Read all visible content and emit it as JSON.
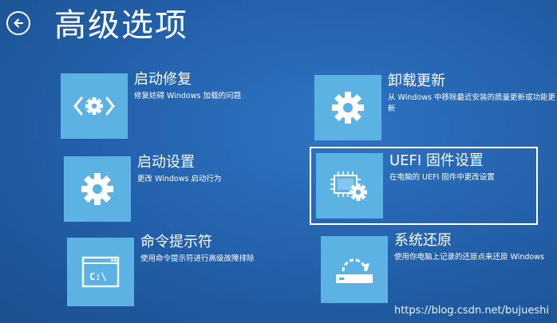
{
  "header": {
    "title": "高级选项",
    "back_icon": "back-arrow-icon"
  },
  "options": [
    {
      "name": "启动修复",
      "description": "修复妨碍 Windows 加载的问题",
      "icon": "wrench-gear-icon"
    },
    {
      "name": "卸载更新",
      "description": "从 Windows 中移除最近安装的质量更新或功能更新",
      "icon": "gear-icon"
    },
    {
      "name": "启动设置",
      "description": "更改 Windows 启动行为",
      "icon": "gear-icon"
    },
    {
      "name": "UEFI 固件设置",
      "description": "在电脑的 UEFI 固件中更改设置",
      "icon": "chip-gear-icon"
    },
    {
      "name": "命令提示符",
      "description": "使用命令提示符进行高级故障排除",
      "icon": "command-prompt-icon"
    },
    {
      "name": "系统还原",
      "description": "使用你电脑上记录的还原点来还原 Windows",
      "icon": "system-restore-icon"
    }
  ],
  "icon_text": {
    "cmd": "C:\\"
  },
  "colors": {
    "background": "#225fa8",
    "tile": "#5cb3e3",
    "text": "#ffffff"
  },
  "watermark": "https://blog.csdn.net/bujueshi"
}
